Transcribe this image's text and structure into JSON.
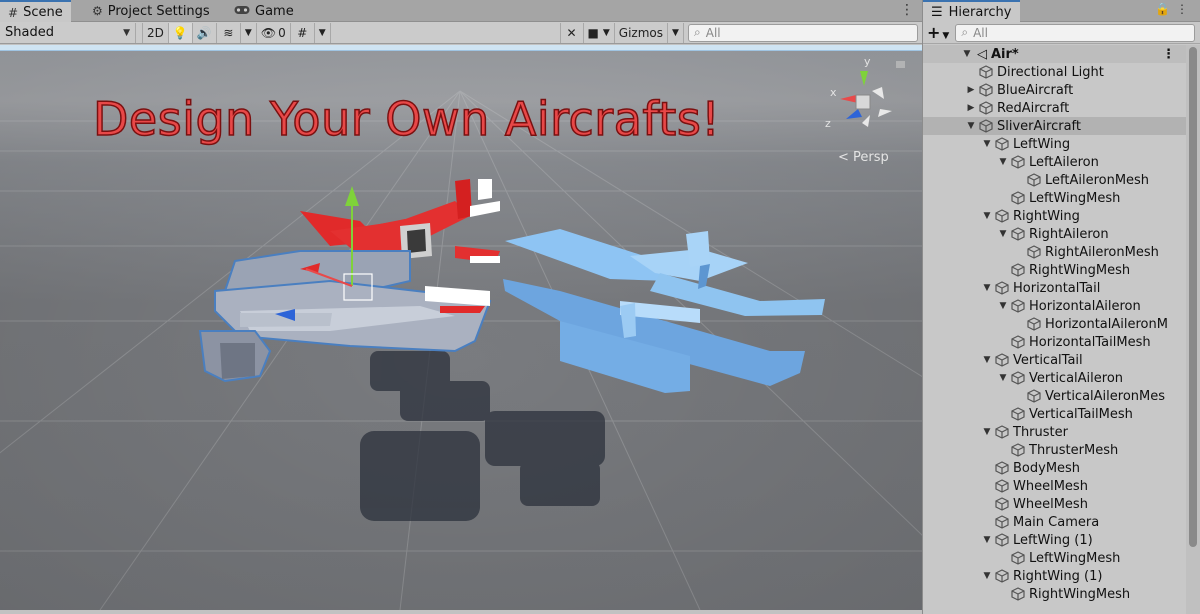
{
  "scene_tabs": [
    {
      "label": "Scene",
      "icon": "grid-icon"
    },
    {
      "label": "Project Settings",
      "icon": "gear-icon"
    },
    {
      "label": "Game",
      "icon": "gamepad-icon"
    }
  ],
  "toolbar": {
    "shading_mode": "Shaded",
    "twod_label": "2D",
    "hidden_count": "0",
    "gizmos_label": "Gizmos",
    "search_placeholder": "All"
  },
  "viewport": {
    "headline": "Design Your Own Aircrafts!",
    "projection_label": "Persp",
    "gizmo_axes": {
      "y": "y",
      "x": "x",
      "z": "z"
    }
  },
  "hierarchy": {
    "tab_label": "Hierarchy",
    "add_label": "+",
    "search_placeholder": "All",
    "scene_name": "Air*",
    "items": [
      {
        "label": "Directional Light",
        "depth": 1,
        "fold": ""
      },
      {
        "label": "BlueAircraft",
        "depth": 1,
        "fold": "collapsed"
      },
      {
        "label": "RedAircraft",
        "depth": 1,
        "fold": "collapsed"
      },
      {
        "label": "SliverAircraft",
        "depth": 1,
        "fold": "expanded",
        "selected": true
      },
      {
        "label": "LeftWing",
        "depth": 2,
        "fold": "expanded"
      },
      {
        "label": "LeftAileron",
        "depth": 3,
        "fold": "expanded"
      },
      {
        "label": "LeftAileronMesh",
        "depth": 4,
        "fold": ""
      },
      {
        "label": "LeftWingMesh",
        "depth": 3,
        "fold": ""
      },
      {
        "label": "RightWing",
        "depth": 2,
        "fold": "expanded"
      },
      {
        "label": "RightAileron",
        "depth": 3,
        "fold": "expanded"
      },
      {
        "label": "RightAileronMesh",
        "depth": 4,
        "fold": ""
      },
      {
        "label": "RightWingMesh",
        "depth": 3,
        "fold": ""
      },
      {
        "label": "HorizontalTail",
        "depth": 2,
        "fold": "expanded"
      },
      {
        "label": "HorizontalAileron",
        "depth": 3,
        "fold": "expanded"
      },
      {
        "label": "HorizontalAileronM",
        "depth": 4,
        "fold": ""
      },
      {
        "label": "HorizontalTailMesh",
        "depth": 3,
        "fold": ""
      },
      {
        "label": "VerticalTail",
        "depth": 2,
        "fold": "expanded"
      },
      {
        "label": "VerticalAileron",
        "depth": 3,
        "fold": "expanded"
      },
      {
        "label": "VerticalAileronMes",
        "depth": 4,
        "fold": ""
      },
      {
        "label": "VerticalTailMesh",
        "depth": 3,
        "fold": ""
      },
      {
        "label": "Thruster",
        "depth": 2,
        "fold": "expanded"
      },
      {
        "label": "ThrusterMesh",
        "depth": 3,
        "fold": ""
      },
      {
        "label": "BodyMesh",
        "depth": 2,
        "fold": ""
      },
      {
        "label": "WheelMesh",
        "depth": 2,
        "fold": ""
      },
      {
        "label": "WheelMesh",
        "depth": 2,
        "fold": ""
      },
      {
        "label": "Main Camera",
        "depth": 2,
        "fold": ""
      },
      {
        "label": "LeftWing (1)",
        "depth": 2,
        "fold": "expanded"
      },
      {
        "label": "LeftWingMesh",
        "depth": 3,
        "fold": ""
      },
      {
        "label": "RightWing (1)",
        "depth": 2,
        "fold": "expanded"
      },
      {
        "label": "RightWingMesh",
        "depth": 3,
        "fold": ""
      }
    ]
  },
  "colors": {
    "headline": "#e84848",
    "red_aircraft": "#e12a2a",
    "blue_aircraft": "#7fb6ea",
    "silver_aircraft": "#9aa3b4",
    "selection_outline": "#4a7fc0"
  }
}
